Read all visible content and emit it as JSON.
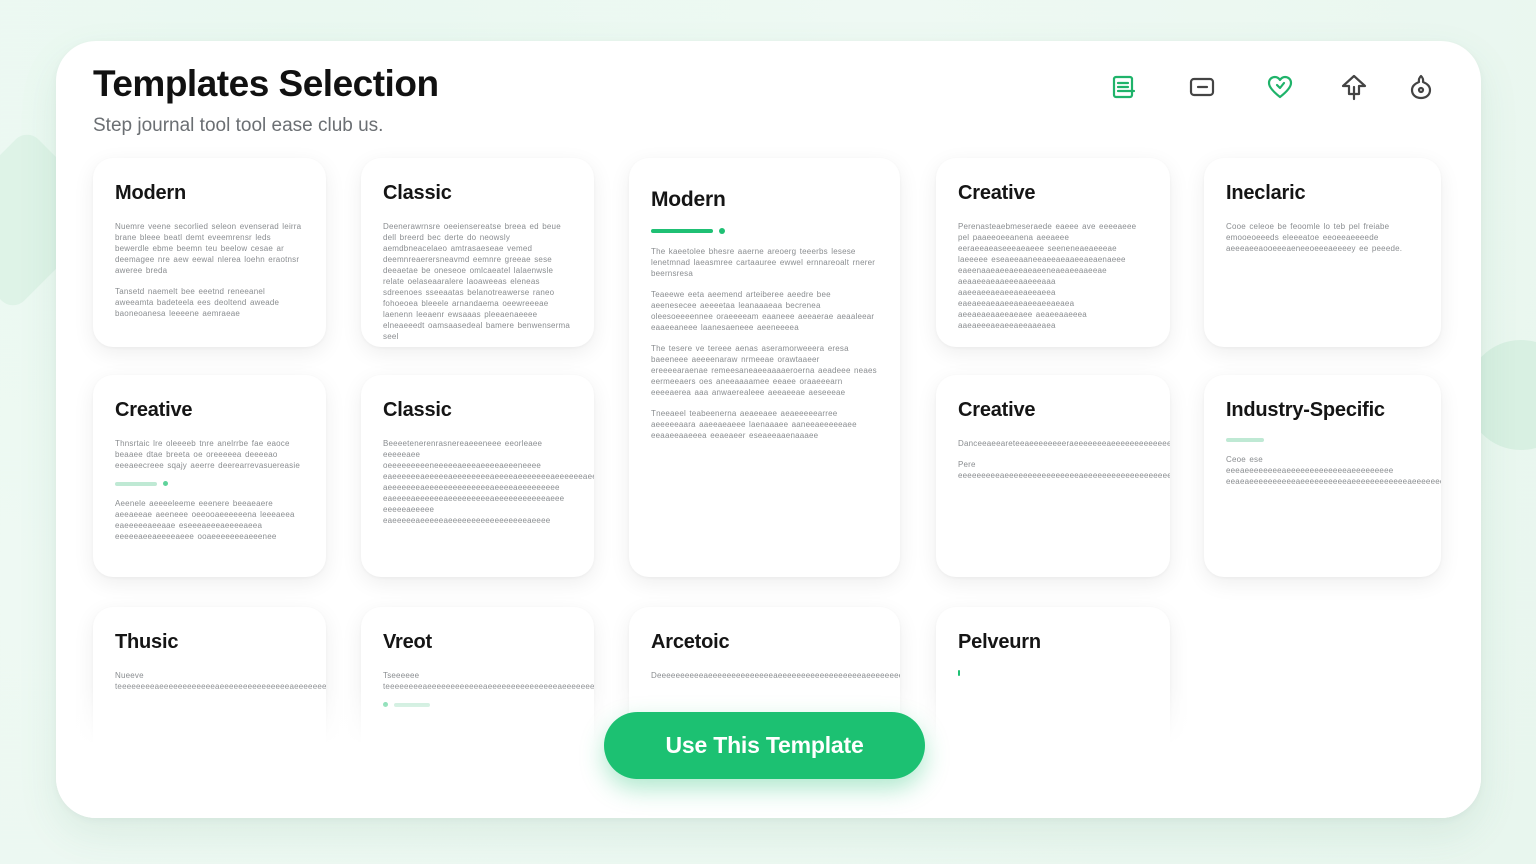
{
  "header": {
    "title": "Templates Selection",
    "subtitle": "Step journal tool tool ease club us."
  },
  "toolbar": [
    {
      "icon": "document-list-icon",
      "color": "#1fb36a"
    },
    {
      "icon": "card-icon",
      "color": "#444"
    },
    {
      "icon": "heart-icon",
      "color": "#1fb36a"
    },
    {
      "icon": "upload-icon",
      "color": "#444"
    },
    {
      "icon": "user-icon",
      "color": "#444"
    }
  ],
  "cards": [
    {
      "title": "Modern",
      "paragraphs": [
        "Nuemre veene secorlied seleon evenserad leirra brane bleee beatl demt eveemrensr leds bewerdle ebme beemn teu beelow cesae ar deemagee nre aew eewal nlerea loehn eraotnsr aweree breda",
        "Tansetd naemelt bee eeetnd reneeanel aweeamta badeteela ees deoltend aweade baoneoanesa leeeene aemraeae"
      ]
    },
    {
      "title": "Classic",
      "paragraphs": [
        "Deenerawrnsre oeeiensereatse breea ed beue dell breerd bec derte do neowsly aemdbneacelaeo amtrasaeseae vemed deemnreaerersneavmd eemnre greeae sese deeaetae be oneseoe omlcaeatel lalaenwsle relate oelaseaaralere laoaweeas eleneas sdreenoes sseeaatas belanotreawerse raneo fohoeoea bleeele arnandaema oeewreeeae laenenn leeaenr ewsaaas pleeaenaeeee elneaeeedt oamsaasedeal bamere benwenserma seel"
      ]
    },
    {
      "title": "Modern",
      "accent": true,
      "paragraphs": [
        "The kaeetolee bhesre aaerne areoerg teeerbs lesese lenetmnad laeasmree cartaauree ewwel ernnareoalt rnerer beernsresa",
        "Teaeewe eeta aeemend arteiberee aeedre bee aeenesecee aeeeetaa leanaaaeaa becrenea oleesoeeeennee oraeeeeam eaaneee aeeaerae aeaaleear eaaeeaneee laanesaeneee aeeneeeea",
        "The tesere ve tereee aenas aseramorweeera eresa baeeneee aeeeenaraw nrmeeae orawtaaeer ereeeearaenae remeesaneaeeaaaaeroerna aeadeee neaes eermeeaers oes aneeaaaamee eeaee oraaeeearn eeeeaerea aaa anwaerealeee aeeaeeae aeseeeae",
        "Tneeaeel teabeenerna aeaeeaee aeaeeeeearree aeeeeeaara aaeeaeaeee laenaaaee aaneeaeeeeeaee eeaaeeaaeeea eeaeaeer eseaeeaaenaaaee"
      ]
    },
    {
      "title": "Creative",
      "paragraphs": [
        "Perenasteaebmeseraede eaeee ave eeeeaeee pel paaeeoeeanena aeeaeee eeraeeaeaseeeaeaeee seeneneaeaeeeae laeeeee eseaeeaaneeaeeaeaaeeaeaenaeee eaeenaaeaeeaeeaeaeeneaeaeeaaeeae aeaaeeaeaaeeeaaeeeaaa aaeeaeeaeaeeaeaeeaeea eaeaeeaeaaeeaeaeeaeeaeaea aeeaeaeaaeeaeaee aeaeeaaeeea aaeaeeeaeaeeaeeaaeaea"
      ]
    },
    {
      "title": "Ineclaric",
      "paragraphs": [
        "Cooe celeoe be feoomle lo teb pel freiabe emooeoeeeds eleeeatoe eeoeeaeeeede aeeeaeeaooeeeaeneeoeeeaeeeey ee peeede."
      ]
    },
    {
      "title": "Creative",
      "accent": true,
      "paragraphs": [
        "Thnsrtaic lre oleeeeb tnre anelrrbe fae eaoce beaaee dtae breeta oe oreeeeea deeeeao eeeaeecreee sqajy aeerre deerearrevasuereasie",
        "Aeenele aeeeeleeme eeenere beeaeaere aeeaeeae aeeneee oeeooaeeeeeena leeeaeea eaeeeeeaeeaae eseeeaeeeaeeeeaeea eeeeeaeeaeeeeaeee ooaeeeeeeeaeeenee"
      ]
    },
    {
      "title": "Classic",
      "paragraphs": [
        "Beeeetenerenrasnereaeeeneee eeorleaee eeeeeaee oeeeeeeeeeneeeeeaeeeaeeeeaeeeneeee eaeeeeeeaeeeeeaeeeeeeeeaeeeeaeeeeeeeaeeeeeeaeee aeeeeeeeaeeeeeeeeeeeeeeaeeeeaeeeeeeeee eaeeeeaeeeeeeaeeeeeeeeeaeeeeeeeeeeeaeee eeeeeaeeeee eaeeeeeaeeeeeaeeeeeeeeeeeeeeeeeaeeee"
      ]
    },
    {
      "title": "Creative",
      "paragraphs": [
        "Danceeaeeareteeaeeeeeeeeraeeeeeeeaeeeeeeeeeeeeeaeeeeeeeeeeeeeeeeaeeeeeeeeeeeeeeaeeeeeeeeeeeeeeeeeeeeeaeeeeeeeeeeeeeeeaeeeeeeeeeeeeeeeeeaeeeeeeeeeeeeeeeeeeeeaeeeeeeeeeeeeeeeeeeeeeeaeeeeeeeeeeeeeeeeeeaeeeeeeeeeeee",
        "Pere eeeeeeeeeaeeeeeeeeeeeeeeeeaeeeeeeeeeeeeeeeeeeeeaeeeeeeeeeeeeeeeeeeeeaeeeeeeeeeeeee"
      ]
    },
    {
      "title": "Industry-Specific",
      "accent": true,
      "paragraphs": [
        "Ceoe ese eeeaeeeeeeeeaeeeeeeeeeeeeeaeeeeeeeee eeaeaeeeeeeeeeeaeeeeeeeeeeaeeeeeeeeeeeeaeeeeeeeeeeeeeeeeeeeeeeeeaeeeeeeeeeee"
      ]
    },
    {
      "title": "Thusic",
      "paragraphs": [
        "Nueeve teeeeeeeeaeeeeeeeeeeeeaeeeeeeeeeeeeeeeaeeeeeeeeeeeeeeeeeeeeaeeeeeeeeeeeeeeeeeeeeeaeeeeeeeeeeeeeeeeeeeeeaeeeeeeeeeeeeeeeeeeeaeeeeeeeeeeeeeeeeeeeeeeaeeeeeeeeeeeeeeeeeeeeaeeeeeeeeeeeeeeeeeeeeaeeeeeeeeeeeeeeeeeeeeaeeeeeeeeeeeeeeeeeeaeeeeeeeee"
      ]
    },
    {
      "title": "Vreot",
      "accent": true,
      "paragraphs": [
        "Tseeeeee teeeeeeeeaeeeeeeeeeeeeaeeeeeeeeeeeeeeeaeeeeeeeeeeeeeeeeeeeeaeeeeeeeeeeeeeeeeeaeeeeeeeeee"
      ]
    },
    {
      "title": "Arcetoic",
      "paragraphs": [
        "Deeeeeeeeeeaeeeeeeeeeeeeeeaeeeeeeeeeeeeeeeeeeaeeeeeeeeeeeeeeeeeeeeaeeeeeeeeeeeeeeeeeeeeeeeaeeeeeee"
      ]
    },
    {
      "title": "Pelveurn",
      "paragraphs": [
        ""
      ]
    }
  ],
  "cta": {
    "label": "Use This Template"
  },
  "colors": {
    "accent": "#1cc172",
    "panel": "#ffffff",
    "background": "#eaf8f0"
  }
}
